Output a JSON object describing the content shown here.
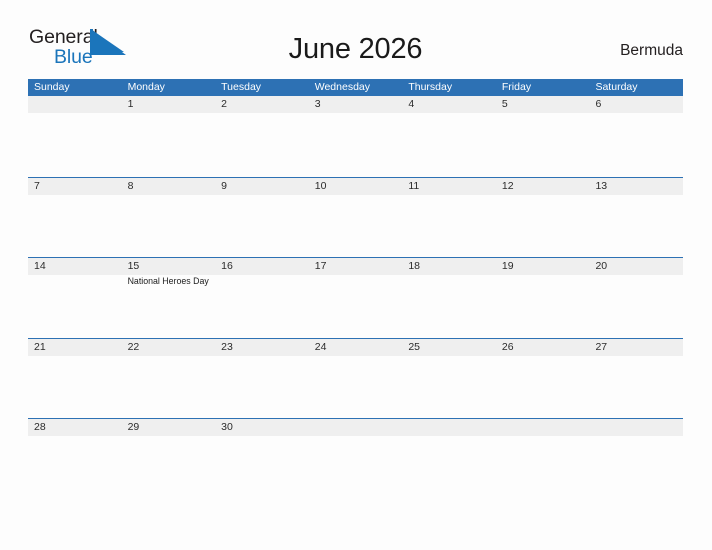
{
  "brand": {
    "name_part1": "General",
    "name_part2": "Blue",
    "flag_icon": "blue-flag-triangle-icon",
    "color_dark": "#231f20",
    "color_blue": "#1b75bb"
  },
  "header": {
    "title": "June 2026",
    "location": "Bermuda"
  },
  "theme": {
    "header_blue": "#2d71b4",
    "band_gray": "#efefef",
    "page_background": "#fdfdfd",
    "text_color": "#2b2b2b"
  },
  "calendar": {
    "month": "June",
    "year": "2026",
    "weekday_headers": [
      "Sunday",
      "Monday",
      "Tuesday",
      "Wednesday",
      "Thursday",
      "Friday",
      "Saturday"
    ],
    "weeks": [
      {
        "days": [
          {
            "num": "",
            "events": []
          },
          {
            "num": "1",
            "events": []
          },
          {
            "num": "2",
            "events": []
          },
          {
            "num": "3",
            "events": []
          },
          {
            "num": "4",
            "events": []
          },
          {
            "num": "5",
            "events": []
          },
          {
            "num": "6",
            "events": []
          }
        ]
      },
      {
        "days": [
          {
            "num": "7",
            "events": []
          },
          {
            "num": "8",
            "events": []
          },
          {
            "num": "9",
            "events": []
          },
          {
            "num": "10",
            "events": []
          },
          {
            "num": "11",
            "events": []
          },
          {
            "num": "12",
            "events": []
          },
          {
            "num": "13",
            "events": []
          }
        ]
      },
      {
        "days": [
          {
            "num": "14",
            "events": []
          },
          {
            "num": "15",
            "events": [
              "National Heroes Day"
            ]
          },
          {
            "num": "16",
            "events": []
          },
          {
            "num": "17",
            "events": []
          },
          {
            "num": "18",
            "events": []
          },
          {
            "num": "19",
            "events": []
          },
          {
            "num": "20",
            "events": []
          }
        ]
      },
      {
        "days": [
          {
            "num": "21",
            "events": []
          },
          {
            "num": "22",
            "events": []
          },
          {
            "num": "23",
            "events": []
          },
          {
            "num": "24",
            "events": []
          },
          {
            "num": "25",
            "events": []
          },
          {
            "num": "26",
            "events": []
          },
          {
            "num": "27",
            "events": []
          }
        ]
      },
      {
        "days": [
          {
            "num": "28",
            "events": []
          },
          {
            "num": "29",
            "events": []
          },
          {
            "num": "30",
            "events": []
          },
          {
            "num": "",
            "events": []
          },
          {
            "num": "",
            "events": []
          },
          {
            "num": "",
            "events": []
          },
          {
            "num": "",
            "events": []
          }
        ]
      }
    ]
  }
}
